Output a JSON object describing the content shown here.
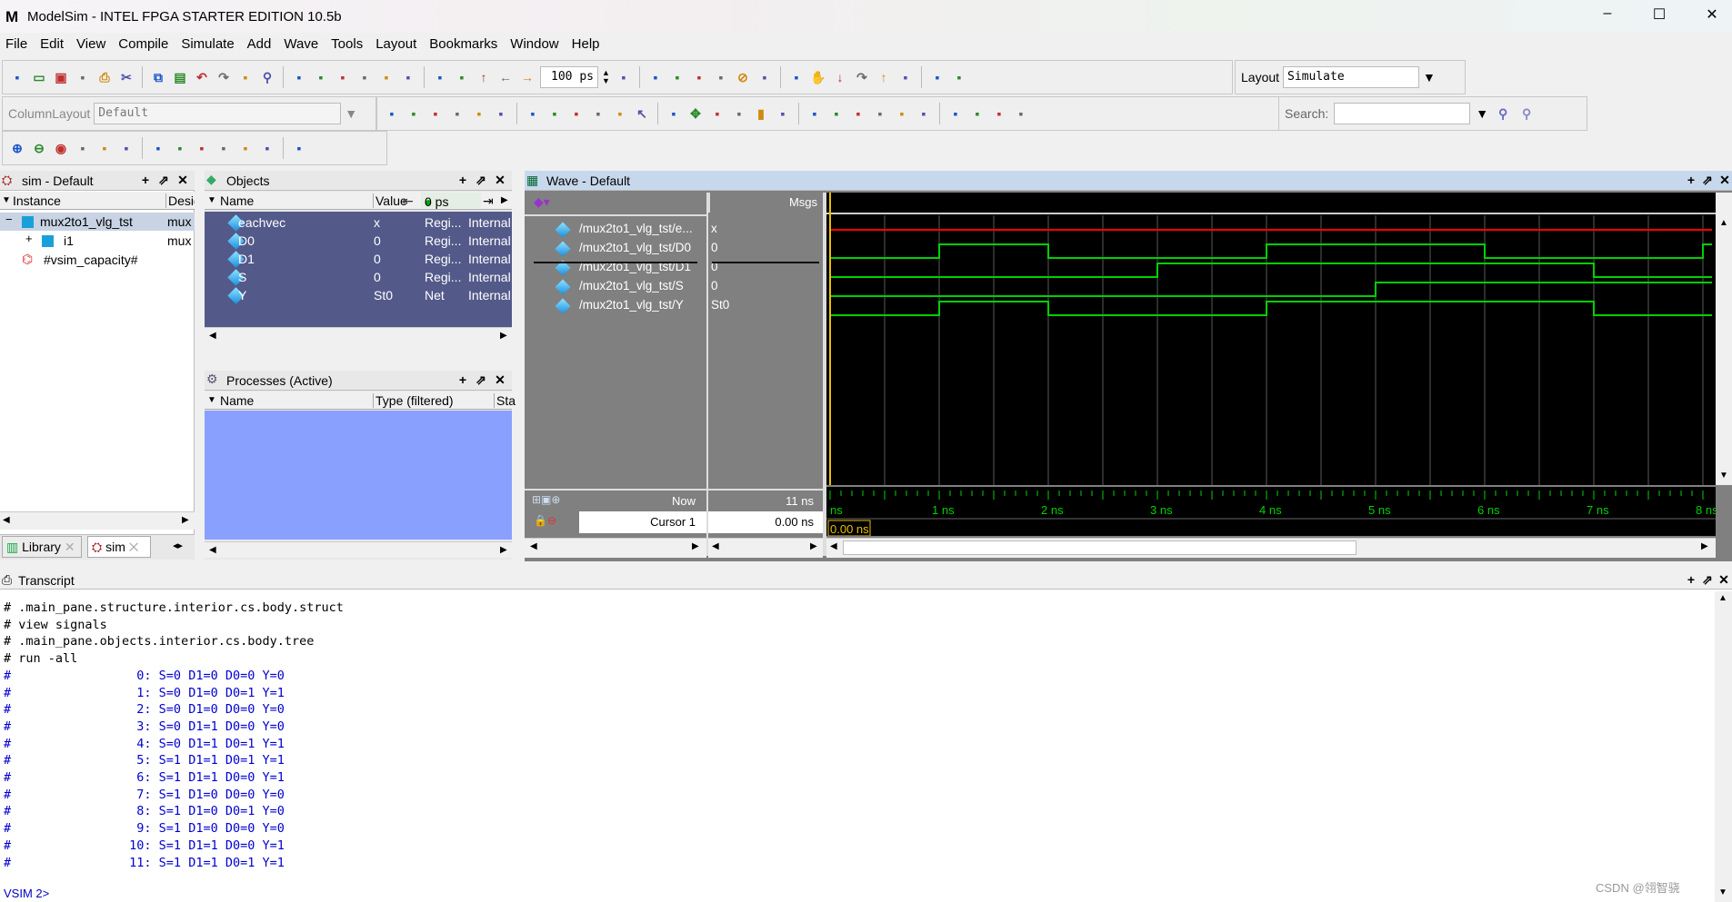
{
  "window": {
    "title": "ModelSim - INTEL FPGA STARTER EDITION 10.5b",
    "logo": "M",
    "minimize": "–",
    "maximize": "☐",
    "close": "✕"
  },
  "menu": [
    "File",
    "Edit",
    "View",
    "Compile",
    "Simulate",
    "Add",
    "Wave",
    "Tools",
    "Layout",
    "Bookmarks",
    "Window",
    "Help"
  ],
  "toolbar": {
    "run_length": "100 ps",
    "layout_label": "Layout",
    "layout_value": "Simulate",
    "column_layout_label": "ColumnLayout",
    "column_layout_value": "Default",
    "search_label": "Search:",
    "search_value": "",
    "row1_icons": [
      "new-file",
      "open-folder",
      "save",
      "reload",
      "print",
      "cut",
      "copy",
      "paste",
      "undo",
      "redo",
      "compile",
      "find",
      "outline",
      "modelsim-m",
      "step-into",
      "wave-compare",
      "memory",
      "break",
      "delete",
      "restart",
      "up-arrow",
      "back",
      "forward",
      "run-length",
      "run",
      "continue",
      "run-all",
      "break-stop",
      "stop",
      "performance",
      "coverage",
      "hand",
      "step",
      "step-over",
      "step-out",
      "step-down",
      "step-wrap",
      "step-up"
    ],
    "row2_icons": [
      "add-wave",
      "add-list",
      "add-log",
      "add-dataflow",
      "add-memory",
      "radix-a",
      "radix-b",
      "radix-c",
      "radix-d",
      "radix-e",
      "radix-f",
      "select-cursor",
      "zoom-box",
      "move",
      "insert-cursor",
      "delete-cursor",
      "traffic-light",
      "edge-rise",
      "edge-fall",
      "prev-transition",
      "next-transition",
      "find-prev",
      "find-next",
      "find-first",
      "find-last",
      "expand-left",
      "expand-right",
      "expand-all",
      "search-go",
      "search-opts",
      "search-clear"
    ],
    "row3_icons": [
      "zoom-in",
      "zoom-out",
      "zoom-full",
      "zoom-cursor",
      "zoom-range",
      "zoom-last",
      "wave-logic",
      "wave-bus",
      "wave-full",
      "grid",
      "dotted-a",
      "dotted-b",
      "dotted-c"
    ]
  },
  "sim_pane": {
    "title": "sim - Default",
    "columns": [
      "Instance",
      "Design"
    ],
    "rows": [
      {
        "name": "mux2to1_vlg_tst",
        "design": "mux",
        "expander": "−"
      },
      {
        "name": "i1",
        "design": "mux",
        "expander": "+"
      },
      {
        "name": "#vsim_capacity#",
        "design": ""
      }
    ],
    "tabs": [
      {
        "label": "Library"
      },
      {
        "label": "sim"
      }
    ]
  },
  "objects_pane": {
    "title": "Objects",
    "columns": [
      "Name",
      "Value"
    ],
    "time_display": "0 ps",
    "rows": [
      {
        "name": "eachvec",
        "value": "x",
        "kind": "Regi...",
        "mode": "Internal"
      },
      {
        "name": "D0",
        "value": "0",
        "kind": "Regi...",
        "mode": "Internal"
      },
      {
        "name": "D1",
        "value": "0",
        "kind": "Regi...",
        "mode": "Internal"
      },
      {
        "name": "S",
        "value": "0",
        "kind": "Regi...",
        "mode": "Internal"
      },
      {
        "name": "Y",
        "value": "St0",
        "kind": "Net",
        "mode": "Internal"
      }
    ]
  },
  "processes_pane": {
    "title": "Processes (Active)",
    "columns": [
      "Name",
      "Type (filtered)",
      "Sta"
    ]
  },
  "wave": {
    "title": "Wave - Default",
    "msgs_label": "Msgs",
    "now_label": "Now",
    "now_value": "11 ns",
    "cursor_label": "Cursor 1",
    "cursor_value": "0.00 ns",
    "cursor_marker": "0.00 ns",
    "time_ticks": [
      "ns",
      "1 ns",
      "2 ns",
      "3 ns",
      "4 ns",
      "5 ns",
      "6 ns",
      "7 ns",
      "8 ns"
    ],
    "colors": {
      "background": "#000000",
      "logic": "#00d000",
      "unknown": "#ff0000",
      "cursor": "#e8c000",
      "grid": "#5a5a5a",
      "tick_text": "#00d000"
    },
    "signals": [
      {
        "name": "/mux2to1_vlg_tst/e...",
        "value": "x",
        "transitions": [
          [
            0,
            "x"
          ]
        ]
      },
      {
        "name": "/mux2to1_vlg_tst/D0",
        "value": "0",
        "transitions": [
          [
            0,
            0
          ],
          [
            1,
            1
          ],
          [
            2,
            0
          ],
          [
            4,
            1
          ],
          [
            6,
            0
          ],
          [
            8,
            1
          ]
        ]
      },
      {
        "name": "/mux2to1_vlg_tst/D1",
        "value": "0",
        "transitions": [
          [
            0,
            0
          ],
          [
            3,
            1
          ],
          [
            7,
            0
          ]
        ]
      },
      {
        "name": "/mux2to1_vlg_tst/S",
        "value": "0",
        "transitions": [
          [
            0,
            0
          ],
          [
            5,
            1
          ]
        ]
      },
      {
        "name": "/mux2to1_vlg_tst/Y",
        "value": "St0",
        "transitions": [
          [
            0,
            0
          ],
          [
            1,
            1
          ],
          [
            2,
            0
          ],
          [
            4,
            1
          ],
          [
            7,
            0
          ]
        ]
      }
    ]
  },
  "transcript": {
    "title": "Transcript",
    "lines": [
      {
        "text": "# .main_pane.structure.interior.cs.body.struct",
        "kind": "cmd"
      },
      {
        "text": "# view signals",
        "kind": "cmd"
      },
      {
        "text": "# .main_pane.objects.interior.cs.body.tree",
        "kind": "cmd"
      },
      {
        "text": "# run -all",
        "kind": "cmd"
      },
      {
        "text": "#                 0: S=0 D1=0 D0=0 Y=0",
        "kind": "out"
      },
      {
        "text": "#                 1: S=0 D1=0 D0=1 Y=1",
        "kind": "out"
      },
      {
        "text": "#                 2: S=0 D1=0 D0=0 Y=0",
        "kind": "out"
      },
      {
        "text": "#                 3: S=0 D1=1 D0=0 Y=0",
        "kind": "out"
      },
      {
        "text": "#                 4: S=0 D1=1 D0=1 Y=1",
        "kind": "out"
      },
      {
        "text": "#                 5: S=1 D1=1 D0=1 Y=1",
        "kind": "out"
      },
      {
        "text": "#                 6: S=1 D1=1 D0=0 Y=1",
        "kind": "out"
      },
      {
        "text": "#                 7: S=1 D1=0 D0=0 Y=0",
        "kind": "out"
      },
      {
        "text": "#                 8: S=1 D1=0 D0=1 Y=0",
        "kind": "out"
      },
      {
        "text": "#                 9: S=1 D1=0 D0=0 Y=0",
        "kind": "out"
      },
      {
        "text": "#                10: S=1 D1=1 D0=0 Y=1",
        "kind": "out"
      },
      {
        "text": "#                11: S=1 D1=1 D0=1 Y=1",
        "kind": "out"
      }
    ],
    "prompt": "VSIM 2>"
  },
  "watermark": "CSDN @翎智骁"
}
